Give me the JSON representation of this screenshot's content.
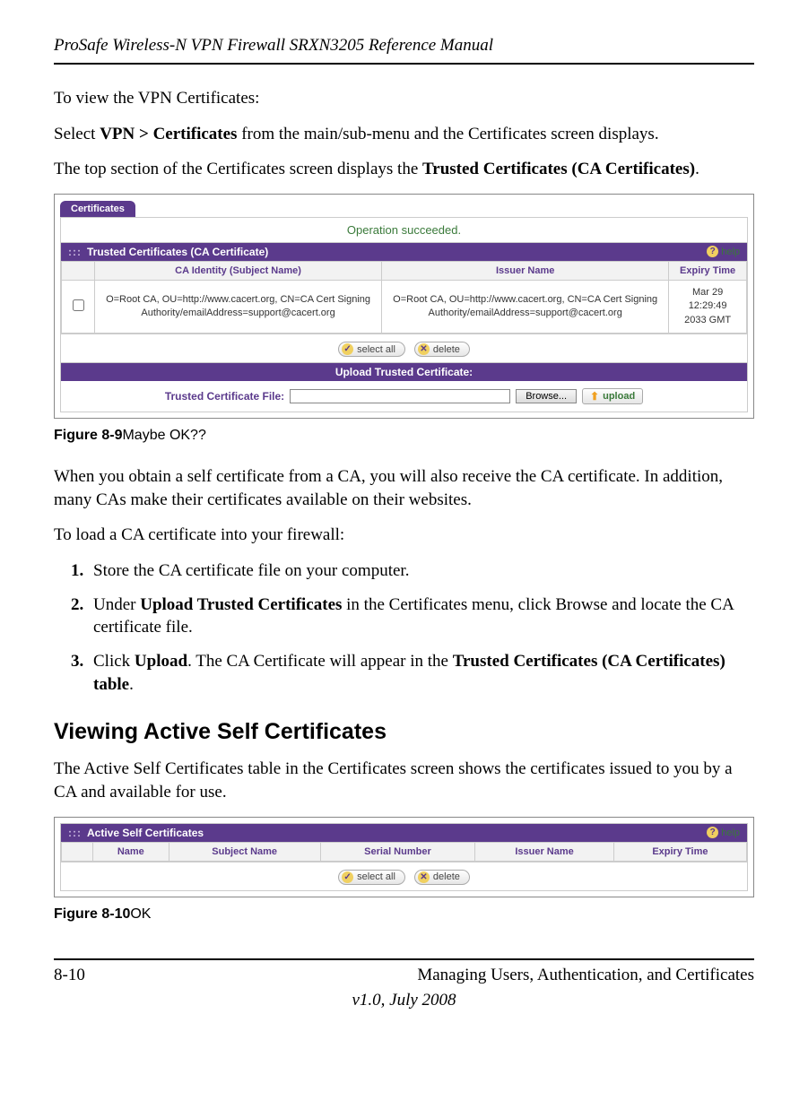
{
  "header": {
    "title": "ProSafe Wireless-N VPN Firewall SRXN3205 Reference Manual"
  },
  "intro": {
    "p1": "To view the VPN Certificates:",
    "p2_a": "Select ",
    "p2_b": "VPN > Certificates",
    "p2_c": " from the main/sub-menu and the Certificates screen displays.",
    "p3_a": "The top section of the Certificates screen displays the ",
    "p3_b": "Trusted Certificates (CA Certificates)",
    "p3_c": "."
  },
  "fig1": {
    "tab_label": "Certificates",
    "op_msg": "Operation succeeded.",
    "section_title": "Trusted Certificates (CA Certificate)",
    "help_label": "help",
    "cols": {
      "identity": "CA Identity (Subject Name)",
      "issuer": "Issuer Name",
      "expiry": "Expiry Time"
    },
    "row1": {
      "identity": "O=Root CA, OU=http://www.cacert.org, CN=CA Cert Signing Authority/emailAddress=support@cacert.org",
      "issuer": "O=Root CA, OU=http://www.cacert.org, CN=CA Cert Signing Authority/emailAddress=support@cacert.org",
      "expiry": "Mar 29 12:29:49 2033 GMT"
    },
    "btn_select_all": "select all",
    "btn_delete": "delete",
    "upload_title": "Upload Trusted Certificate:",
    "upload_label": "Trusted Certificate File:",
    "browse_label": "Browse...",
    "upload_button": "upload"
  },
  "caption1": {
    "fig": "Figure 8-9",
    "rest": "Maybe OK??"
  },
  "mid": {
    "p1": "When you obtain a self certificate from a CA, you will also receive the CA certificate. In addition, many CAs make their certificates available on their websites.",
    "p2": "To load a CA certificate into your firewall:"
  },
  "list": {
    "i1": "Store the CA certificate file on your computer.",
    "i2_a": "Under ",
    "i2_b": "Upload Trusted Certificates",
    "i2_c": " in the Certificates menu, click Browse and locate the CA certificate file.",
    "i3_a": "Click ",
    "i3_b": "Upload",
    "i3_c": ". The CA Certificate will appear in the ",
    "i3_d": "Trusted Certificates (CA Certificates) table",
    "i3_e": "."
  },
  "h2": "Viewing Active Self Certificates",
  "after_h2": "The Active Self Certificates table in the Certificates screen shows the certificates issued to you by a CA and available for use.",
  "fig2": {
    "section_title": "Active Self Certificates",
    "help_label": "help",
    "cols": {
      "name": "Name",
      "subject": "Subject Name",
      "serial": "Serial Number",
      "issuer": "Issuer Name",
      "expiry": "Expiry Time"
    },
    "btn_select_all": "select all",
    "btn_delete": "delete"
  },
  "caption2": {
    "fig": "Figure 8-10",
    "rest": "OK"
  },
  "footer": {
    "page": "8-10",
    "chapter": "Managing Users, Authentication, and Certificates",
    "version": "v1.0, July 2008"
  }
}
